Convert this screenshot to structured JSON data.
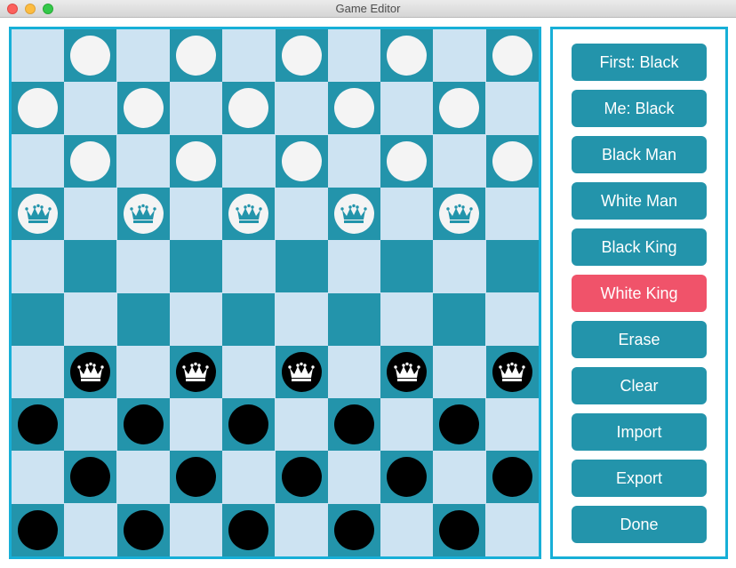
{
  "window": {
    "title": "Game Editor"
  },
  "board": {
    "rows": 10,
    "cols": 10,
    "colors": {
      "light": "#cde3f2",
      "dark": "#2394ab",
      "border": "#17afd7",
      "white_piece": "#f4f4f4",
      "black_piece": "#000000",
      "crown_on_white": "#2394ab",
      "crown_on_black": "#ffffff"
    },
    "pieces": [
      {
        "row": 0,
        "col": 1,
        "color": "white",
        "kind": "man"
      },
      {
        "row": 0,
        "col": 3,
        "color": "white",
        "kind": "man"
      },
      {
        "row": 0,
        "col": 5,
        "color": "white",
        "kind": "man"
      },
      {
        "row": 0,
        "col": 7,
        "color": "white",
        "kind": "man"
      },
      {
        "row": 0,
        "col": 9,
        "color": "white",
        "kind": "man"
      },
      {
        "row": 1,
        "col": 0,
        "color": "white",
        "kind": "man"
      },
      {
        "row": 1,
        "col": 2,
        "color": "white",
        "kind": "man"
      },
      {
        "row": 1,
        "col": 4,
        "color": "white",
        "kind": "man"
      },
      {
        "row": 1,
        "col": 6,
        "color": "white",
        "kind": "man"
      },
      {
        "row": 1,
        "col": 8,
        "color": "white",
        "kind": "man"
      },
      {
        "row": 2,
        "col": 1,
        "color": "white",
        "kind": "man"
      },
      {
        "row": 2,
        "col": 3,
        "color": "white",
        "kind": "man"
      },
      {
        "row": 2,
        "col": 5,
        "color": "white",
        "kind": "man"
      },
      {
        "row": 2,
        "col": 7,
        "color": "white",
        "kind": "man"
      },
      {
        "row": 2,
        "col": 9,
        "color": "white",
        "kind": "man"
      },
      {
        "row": 3,
        "col": 0,
        "color": "white",
        "kind": "king"
      },
      {
        "row": 3,
        "col": 2,
        "color": "white",
        "kind": "king"
      },
      {
        "row": 3,
        "col": 4,
        "color": "white",
        "kind": "king"
      },
      {
        "row": 3,
        "col": 6,
        "color": "white",
        "kind": "king"
      },
      {
        "row": 3,
        "col": 8,
        "color": "white",
        "kind": "king"
      },
      {
        "row": 6,
        "col": 1,
        "color": "black",
        "kind": "king"
      },
      {
        "row": 6,
        "col": 3,
        "color": "black",
        "kind": "king"
      },
      {
        "row": 6,
        "col": 5,
        "color": "black",
        "kind": "king"
      },
      {
        "row": 6,
        "col": 7,
        "color": "black",
        "kind": "king"
      },
      {
        "row": 6,
        "col": 9,
        "color": "black",
        "kind": "king"
      },
      {
        "row": 7,
        "col": 0,
        "color": "black",
        "kind": "man"
      },
      {
        "row": 7,
        "col": 2,
        "color": "black",
        "kind": "man"
      },
      {
        "row": 7,
        "col": 4,
        "color": "black",
        "kind": "man"
      },
      {
        "row": 7,
        "col": 6,
        "color": "black",
        "kind": "man"
      },
      {
        "row": 7,
        "col": 8,
        "color": "black",
        "kind": "man"
      },
      {
        "row": 8,
        "col": 1,
        "color": "black",
        "kind": "man"
      },
      {
        "row": 8,
        "col": 3,
        "color": "black",
        "kind": "man"
      },
      {
        "row": 8,
        "col": 5,
        "color": "black",
        "kind": "man"
      },
      {
        "row": 8,
        "col": 7,
        "color": "black",
        "kind": "man"
      },
      {
        "row": 8,
        "col": 9,
        "color": "black",
        "kind": "man"
      },
      {
        "row": 9,
        "col": 0,
        "color": "black",
        "kind": "man"
      },
      {
        "row": 9,
        "col": 2,
        "color": "black",
        "kind": "man"
      },
      {
        "row": 9,
        "col": 4,
        "color": "black",
        "kind": "man"
      },
      {
        "row": 9,
        "col": 6,
        "color": "black",
        "kind": "man"
      },
      {
        "row": 9,
        "col": 8,
        "color": "black",
        "kind": "man"
      }
    ]
  },
  "panel": {
    "button_color": "#2394ab",
    "active_color": "#f0536a",
    "buttons": [
      {
        "id": "first-black",
        "label": "First: Black",
        "active": false
      },
      {
        "id": "me-black",
        "label": "Me: Black",
        "active": false
      },
      {
        "id": "black-man",
        "label": "Black Man",
        "active": false
      },
      {
        "id": "white-man",
        "label": "White Man",
        "active": false
      },
      {
        "id": "black-king",
        "label": "Black King",
        "active": false
      },
      {
        "id": "white-king",
        "label": "White King",
        "active": true
      },
      {
        "id": "erase",
        "label": "Erase",
        "active": false
      },
      {
        "id": "clear",
        "label": "Clear",
        "active": false
      },
      {
        "id": "import",
        "label": "Import",
        "active": false
      },
      {
        "id": "export",
        "label": "Export",
        "active": false
      },
      {
        "id": "done",
        "label": "Done",
        "active": false
      }
    ]
  }
}
